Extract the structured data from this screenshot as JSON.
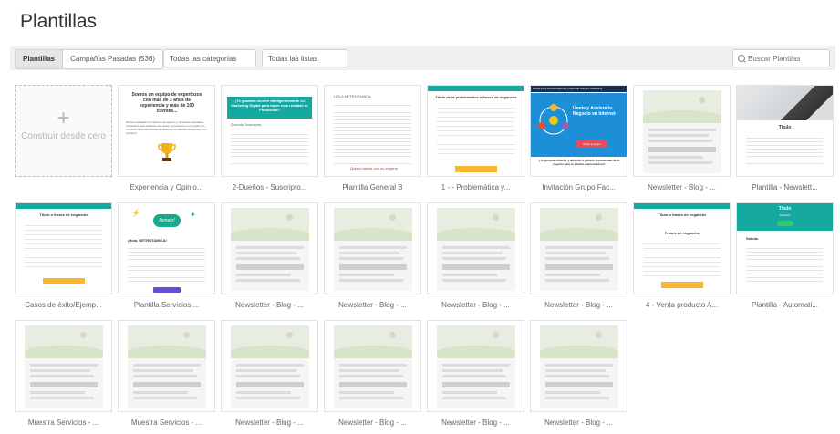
{
  "page": {
    "title": "Plantillas"
  },
  "toolbar": {
    "tabs": [
      {
        "label": "Plantillas",
        "active": true
      },
      {
        "label": "Campañas Pasadas (536)",
        "active": false
      }
    ],
    "categories_dropdown": "Todas las categorías",
    "lists_dropdown": "Todas las listas",
    "search_placeholder": "Buscar Plantilas"
  },
  "build_card": {
    "label": "Construir desde cero"
  },
  "templates": [
    {
      "caption": "Experiencia y Opinio...",
      "preview": "experiencia"
    },
    {
      "caption": "2-Dueños - Suscripto...",
      "preview": "duenos"
    },
    {
      "caption": "Plantilla General B",
      "preview": "general"
    },
    {
      "caption": "1 - - Problemática y...",
      "preview": "problematica"
    },
    {
      "caption": "Invitación Grupo Fac...",
      "preview": "invitacion"
    },
    {
      "caption": "Newsletter - Blog - ...",
      "preview": "placeholder"
    },
    {
      "caption": "Plantilla - Newslett...",
      "preview": "newsletter"
    },
    {
      "caption": "Casos de éxito/Ejemp...",
      "preview": "casos"
    },
    {
      "caption": "Plantilla Servicios ...",
      "preview": "servicios"
    },
    {
      "caption": "Newsletter - Blog - ...",
      "preview": "placeholder"
    },
    {
      "caption": "Newsletter - Blog - ...",
      "preview": "placeholder"
    },
    {
      "caption": "Newsletter - Blog - ...",
      "preview": "placeholder"
    },
    {
      "caption": "Newsletter - Blog - ...",
      "preview": "placeholder"
    },
    {
      "caption": "4 - Venta producto A...",
      "preview": "venta"
    },
    {
      "caption": "Plantilla - Automati...",
      "preview": "automati"
    },
    {
      "caption": "Muestra Servicios - ...",
      "preview": "placeholder"
    },
    {
      "caption": "Muestra Servicios - ...",
      "preview": "placeholder"
    },
    {
      "caption": "Newsletter - Blog - ...",
      "preview": "placeholder"
    },
    {
      "caption": "Newsletter - Blog - ...",
      "preview": "placeholder"
    },
    {
      "caption": "Newsletter - Blog - ...",
      "preview": "placeholder"
    },
    {
      "caption": "Newsletter - Blog - ...",
      "preview": "placeholder"
    }
  ],
  "previews": {
    "experiencia": {
      "heading": "Somos un equipo de expertozos con más de 3 años de experiencia y más de 100 clientes...",
      "body": "Hemos trabajado con dueños de negocio y generado resultados constantes para distintas empresas y proyectos en el mundo con nosotros. Nos conectamos de diversas de clientes satisfechos con nosotros."
    },
    "duenos": {
      "heading": "¿Te gustaría invertir inteligentemente en Marketing Digital para hacer más rentable tu Publicidad?",
      "greeting": "Querido Suscriptor,"
    },
    "general": {
      "greeting": "HOLA NETROTAMICA",
      "cta": "Quiero hablar con un experto"
    },
    "problematica": {
      "heading": "Título de la problemática o frases de enganche",
      "cta": "Accede Aquí"
    },
    "invitacion": {
      "banner": "Grupo para emprendedores y aprende más de marketing",
      "title": "Únete y Acelera tu Negocio en Internet",
      "button": "Únete al grupo",
      "question": "¿Te gustaría conectar y aprender a generar la publicidad de tu negocio para tu pública emprendedora?"
    },
    "newsletter": {
      "title": "Título"
    },
    "casos": {
      "heading": "Título o frases de enganche",
      "cta": "Ver Casos"
    },
    "servicios": {
      "logo": "llamalo!",
      "greeting": "¡Hola, NETROTAMICA!",
      "button": "Ver Servicios"
    },
    "venta": {
      "heading": "Título o frases de enganche",
      "sub": "Frases de enganche",
      "cta": "Acceder Aquí"
    },
    "automati": {
      "title": "Título",
      "sub": "Subtítulo",
      "button": "Comprar",
      "greeting": "Saludo"
    }
  },
  "colors": {
    "teal": "#16a9a1",
    "yellow": "#f7b733",
    "navy": "#1d2d4e"
  }
}
